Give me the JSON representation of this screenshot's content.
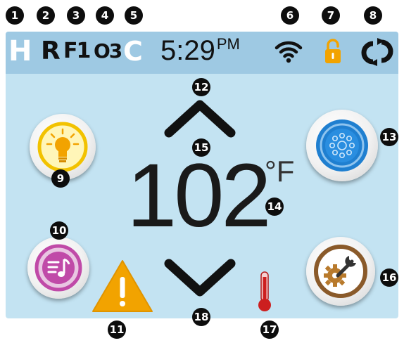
{
  "callouts": [
    "1",
    "2",
    "3",
    "4",
    "5",
    "6",
    "7",
    "8",
    "9",
    "10",
    "11",
    "12",
    "13",
    "14",
    "15",
    "16",
    "17",
    "18"
  ],
  "status_bar": {
    "indicators": [
      "H",
      "R",
      "F1",
      "O3",
      "C"
    ],
    "time": "5:29",
    "ampm": "PM",
    "icons": [
      "wifi-icon",
      "lock-icon",
      "sync-icon"
    ]
  },
  "temperature": {
    "value": "102",
    "unit": "°F"
  },
  "buttons": {
    "light": "lightbulb-icon",
    "jets": "jets-icon",
    "music": "music-icon",
    "settings": "settings-icon",
    "warning": "warning-icon",
    "thermometer": "thermometer-icon",
    "up": "chevron-up-icon",
    "down": "chevron-down-icon"
  },
  "colors": {
    "screen_bg": "#c3e3f2",
    "status_bar_bg": "#9ec9e3",
    "light_accent": "#f2c200",
    "jets_accent": "#1f7fd0",
    "music_accent": "#c04aa8",
    "settings_accent": "#8a5a2a",
    "warning": "#f2a300",
    "lock": "#f2a300",
    "thermometer": "#cc1f1f"
  }
}
